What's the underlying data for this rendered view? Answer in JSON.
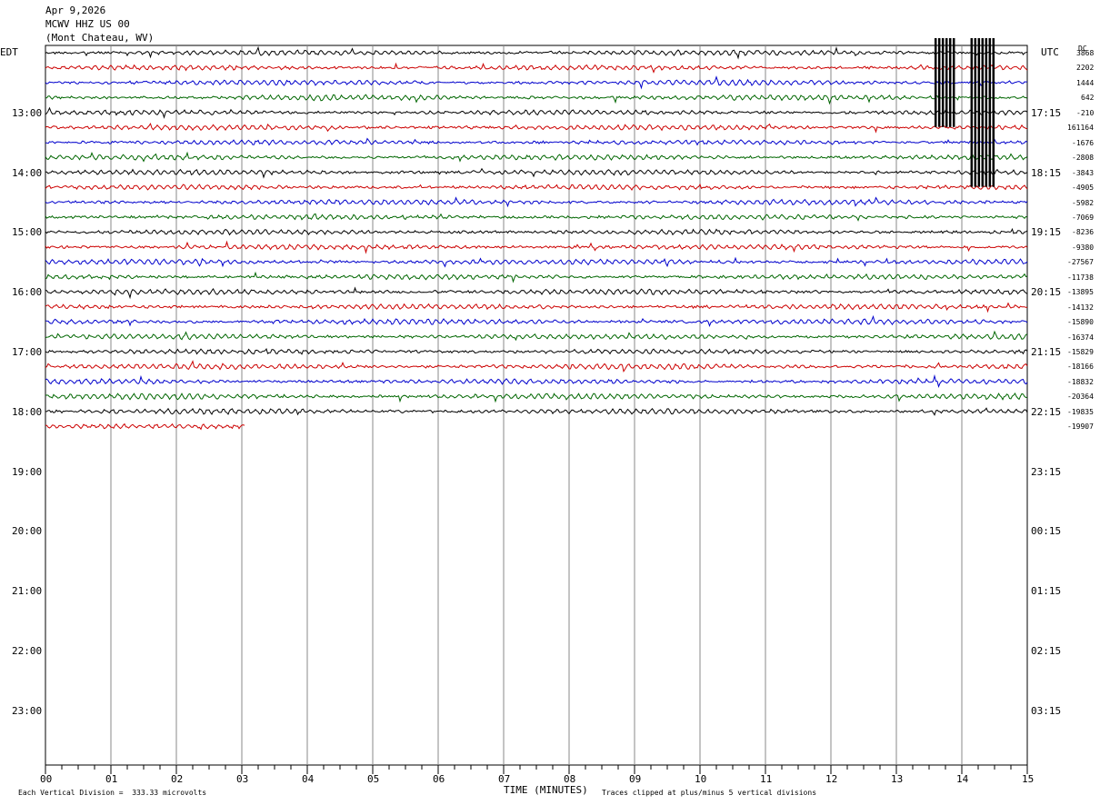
{
  "header": {
    "date": "Apr 9,2026",
    "station": "MCWV HHZ US 00",
    "location": "(Mont Chateau, WV)"
  },
  "axes": {
    "left_label": "EDT",
    "right_label": "UTC",
    "dc_label": "DC",
    "x_label": "TIME (MINUTES)",
    "x_ticks": [
      "00",
      "01",
      "02",
      "03",
      "04",
      "05",
      "06",
      "07",
      "08",
      "09",
      "10",
      "11",
      "12",
      "13",
      "14",
      "15"
    ],
    "left_hours": [
      "13:00",
      "14:00",
      "15:00",
      "16:00",
      "17:00",
      "18:00",
      "19:00",
      "20:00",
      "21:00",
      "22:00",
      "23:00"
    ],
    "right_hours": [
      "17:15",
      "18:15",
      "19:15",
      "20:15",
      "21:15",
      "22:15",
      "23:15",
      "00:15",
      "01:15",
      "02:15",
      "03:15"
    ]
  },
  "footer": {
    "scale_note": "Each Vertical Division =  333.33 microvolts",
    "clip_note": "Traces clipped at plus/minus 5 vertical divisions"
  },
  "dc_offsets": [
    "3868",
    "2202",
    "1444",
    "642",
    "-210",
    "161164",
    "-1676",
    "-2808",
    "-3843",
    "-4905",
    "-5982",
    "-7069",
    "-8236",
    "-9380",
    "-27567",
    "-11738",
    "-13895",
    "-14132",
    "-15890",
    "-16374",
    "-15829",
    "-18166",
    "-18832",
    "-20364",
    "-19835",
    "-19907"
  ],
  "chart_data": {
    "type": "seismogram",
    "x_range_minutes": [
      0,
      15
    ],
    "row_span_minutes": 15,
    "rows_total": 44,
    "trace_colors": [
      "#000000",
      "#cc0000",
      "#0000cc",
      "#006600"
    ],
    "start_time_edt": "12:00",
    "complete_rows": 25,
    "last_row_end_minute": 3.05,
    "clipped_bursts": [
      {
        "rows": [
          0,
          4
        ],
        "minutes": [
          13.6,
          13.9
        ]
      },
      {
        "rows": [
          0,
          8
        ],
        "minutes": [
          14.15,
          14.5
        ]
      }
    ]
  }
}
